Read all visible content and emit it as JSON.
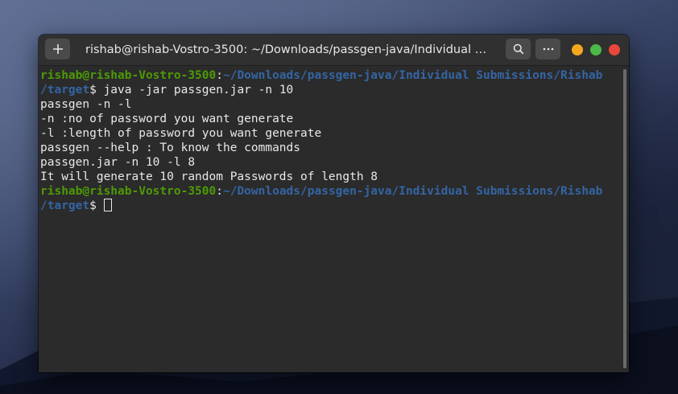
{
  "window": {
    "title": "rishab@rishab-Vostro-3500: ~/Downloads/passgen-java/Individual Submi…"
  },
  "icons": {
    "new_tab": "plus-icon",
    "search": "search-icon",
    "menu": "more-horizontal-icon"
  },
  "colors": {
    "prompt_user": "#4e9a06",
    "prompt_path": "#3465a4",
    "terminal_bg": "#2b2b2b",
    "text": "#e8e8e8",
    "minimize": "#f5a81c",
    "maximize": "#4cb948",
    "close": "#e8473b"
  },
  "terminal": {
    "prompt1": {
      "user": "rishab@rishab-Vostro-3500",
      "sep": ":",
      "path_line1": "~/Downloads/passgen-java/Individual Submissions/Rishab",
      "path_line2": "/target",
      "symbol": "$ ",
      "command": "java -jar passgen.jar -n 10"
    },
    "output": [
      "passgen -n -l",
      "-n :no of password you want generate",
      "-l :length of password you want generate",
      "passgen --help : To know the commands",
      "passgen.jar -n 10 -l 8",
      "It will generate 10 random Passwords of length 8"
    ],
    "prompt2": {
      "user": "rishab@rishab-Vostro-3500",
      "sep": ":",
      "path_line1": "~/Downloads/passgen-java/Individual Submissions/Rishab",
      "path_line2": "/target",
      "symbol": "$ "
    }
  }
}
